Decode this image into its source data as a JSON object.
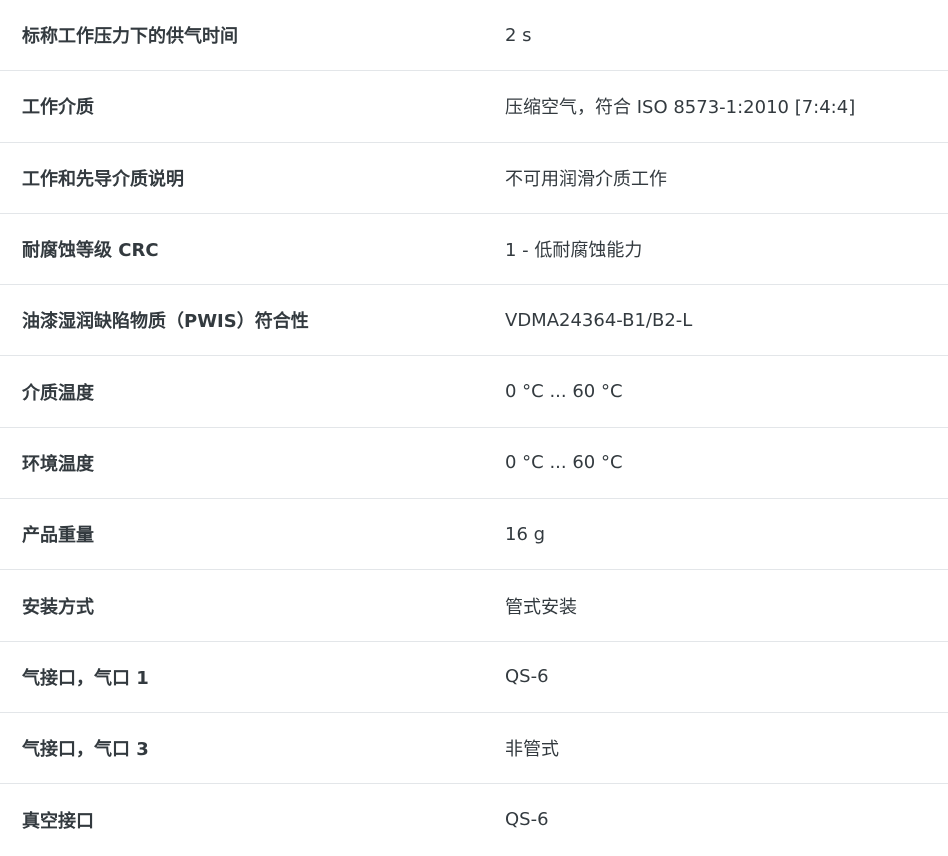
{
  "rows": [
    {
      "label": "标称工作压力下的供气时间",
      "value": "2 s"
    },
    {
      "label": "工作介质",
      "value": "压缩空气，符合 ISO 8573-1:2010 [7:4:4]"
    },
    {
      "label": "工作和先导介质说明",
      "value": "不可用润滑介质工作"
    },
    {
      "label": "耐腐蚀等级 CRC",
      "value": "1 - 低耐腐蚀能力"
    },
    {
      "label": "油漆湿润缺陷物质（PWIS）符合性",
      "value": "VDMA24364-B1/B2-L"
    },
    {
      "label": "介质温度",
      "value": "0 °C ... 60 °C"
    },
    {
      "label": "环境温度",
      "value": "0 °C ... 60 °C"
    },
    {
      "label": "产品重量",
      "value": "16 g"
    },
    {
      "label": "安装方式",
      "value": "管式安装"
    },
    {
      "label": "气接口，气口 1",
      "value": "QS-6"
    },
    {
      "label": "气接口，气口 3",
      "value": "非管式"
    },
    {
      "label": "真空接口",
      "value": "QS-6"
    }
  ]
}
